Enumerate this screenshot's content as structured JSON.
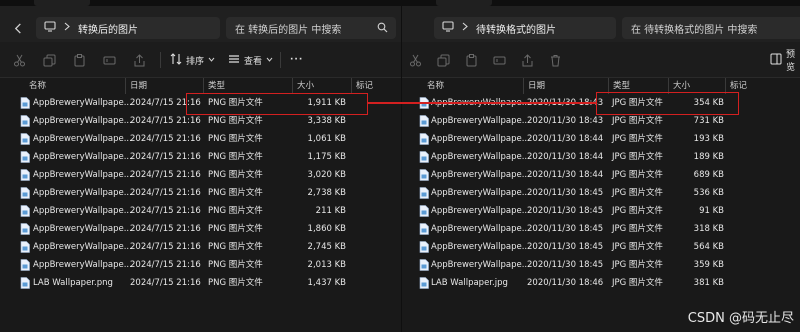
{
  "left": {
    "breadcrumb": "转换后的图片",
    "search_placeholder": "在 转换后的图片 中搜索",
    "toolbar": {
      "sort": "排序",
      "view": "查看",
      "more": "···"
    },
    "columns": {
      "name": "名称",
      "date": "日期",
      "type": "类型",
      "size": "大小",
      "tag": "标记"
    },
    "files": [
      {
        "name": "AppBreweryWallpape...",
        "date": "2024/7/15 21:16",
        "type": "PNG 图片文件",
        "size": "1,911 KB"
      },
      {
        "name": "AppBreweryWallpape...",
        "date": "2024/7/15 21:16",
        "type": "PNG 图片文件",
        "size": "3,338 KB"
      },
      {
        "name": "AppBreweryWallpape...",
        "date": "2024/7/15 21:16",
        "type": "PNG 图片文件",
        "size": "1,061 KB"
      },
      {
        "name": "AppBreweryWallpape...",
        "date": "2024/7/15 21:16",
        "type": "PNG 图片文件",
        "size": "1,175 KB"
      },
      {
        "name": "AppBreweryWallpape...",
        "date": "2024/7/15 21:16",
        "type": "PNG 图片文件",
        "size": "3,020 KB"
      },
      {
        "name": "AppBreweryWallpape...",
        "date": "2024/7/15 21:16",
        "type": "PNG 图片文件",
        "size": "2,738 KB"
      },
      {
        "name": "AppBreweryWallpape...",
        "date": "2024/7/15 21:16",
        "type": "PNG 图片文件",
        "size": "211 KB"
      },
      {
        "name": "AppBreweryWallpape...",
        "date": "2024/7/15 21:16",
        "type": "PNG 图片文件",
        "size": "1,860 KB"
      },
      {
        "name": "AppBreweryWallpape...",
        "date": "2024/7/15 21:16",
        "type": "PNG 图片文件",
        "size": "2,745 KB"
      },
      {
        "name": "AppBreweryWallpape...",
        "date": "2024/7/15 21:16",
        "type": "PNG 图片文件",
        "size": "2,013 KB"
      },
      {
        "name": "LAB Wallpaper.png",
        "date": "2024/7/15 21:16",
        "type": "PNG 图片文件",
        "size": "1,437 KB"
      }
    ]
  },
  "right": {
    "breadcrumb": "待转换格式的图片",
    "search_placeholder": "在 待转换格式的图片 中搜索",
    "toolbar": {
      "preview": "预览"
    },
    "columns": {
      "name": "名称",
      "date": "日期",
      "type": "类型",
      "size": "大小",
      "tag": "标记"
    },
    "files": [
      {
        "name": "AppBreweryWallpape...",
        "date": "2020/11/30 18:43",
        "type": "JPG 图片文件",
        "size": "354 KB"
      },
      {
        "name": "AppBreweryWallpape...",
        "date": "2020/11/30 18:43",
        "type": "JPG 图片文件",
        "size": "731 KB"
      },
      {
        "name": "AppBreweryWallpape...",
        "date": "2020/11/30 18:44",
        "type": "JPG 图片文件",
        "size": "193 KB"
      },
      {
        "name": "AppBreweryWallpape...",
        "date": "2020/11/30 18:44",
        "type": "JPG 图片文件",
        "size": "189 KB"
      },
      {
        "name": "AppBreweryWallpape...",
        "date": "2020/11/30 18:44",
        "type": "JPG 图片文件",
        "size": "689 KB"
      },
      {
        "name": "AppBreweryWallpape...",
        "date": "2020/11/30 18:45",
        "type": "JPG 图片文件",
        "size": "536 KB"
      },
      {
        "name": "AppBreweryWallpape...",
        "date": "2020/11/30 18:45",
        "type": "JPG 图片文件",
        "size": "91 KB"
      },
      {
        "name": "AppBreweryWallpape...",
        "date": "2020/11/30 18:45",
        "type": "JPG 图片文件",
        "size": "318 KB"
      },
      {
        "name": "AppBreweryWallpape...",
        "date": "2020/11/30 18:45",
        "type": "JPG 图片文件",
        "size": "564 KB"
      },
      {
        "name": "AppBreweryWallpape...",
        "date": "2020/11/30 18:45",
        "type": "JPG 图片文件",
        "size": "359 KB"
      },
      {
        "name": "LAB Wallpaper.jpg",
        "date": "2020/11/30 18:46",
        "type": "JPG 图片文件",
        "size": "381 KB"
      }
    ]
  },
  "watermark": "CSDN @码无止尽",
  "colors": {
    "highlight": "#d32020",
    "background": "#191919",
    "file_icon": "#5b9bd5"
  },
  "icons": [
    "monitor-icon",
    "chevron-right-icon",
    "search-icon",
    "cut-icon",
    "copy-icon",
    "paste-icon",
    "rename-icon",
    "share-icon",
    "delete-icon",
    "sort-icon",
    "view-icon",
    "chevron-down-icon",
    "preview-icon",
    "image-file-icon"
  ]
}
